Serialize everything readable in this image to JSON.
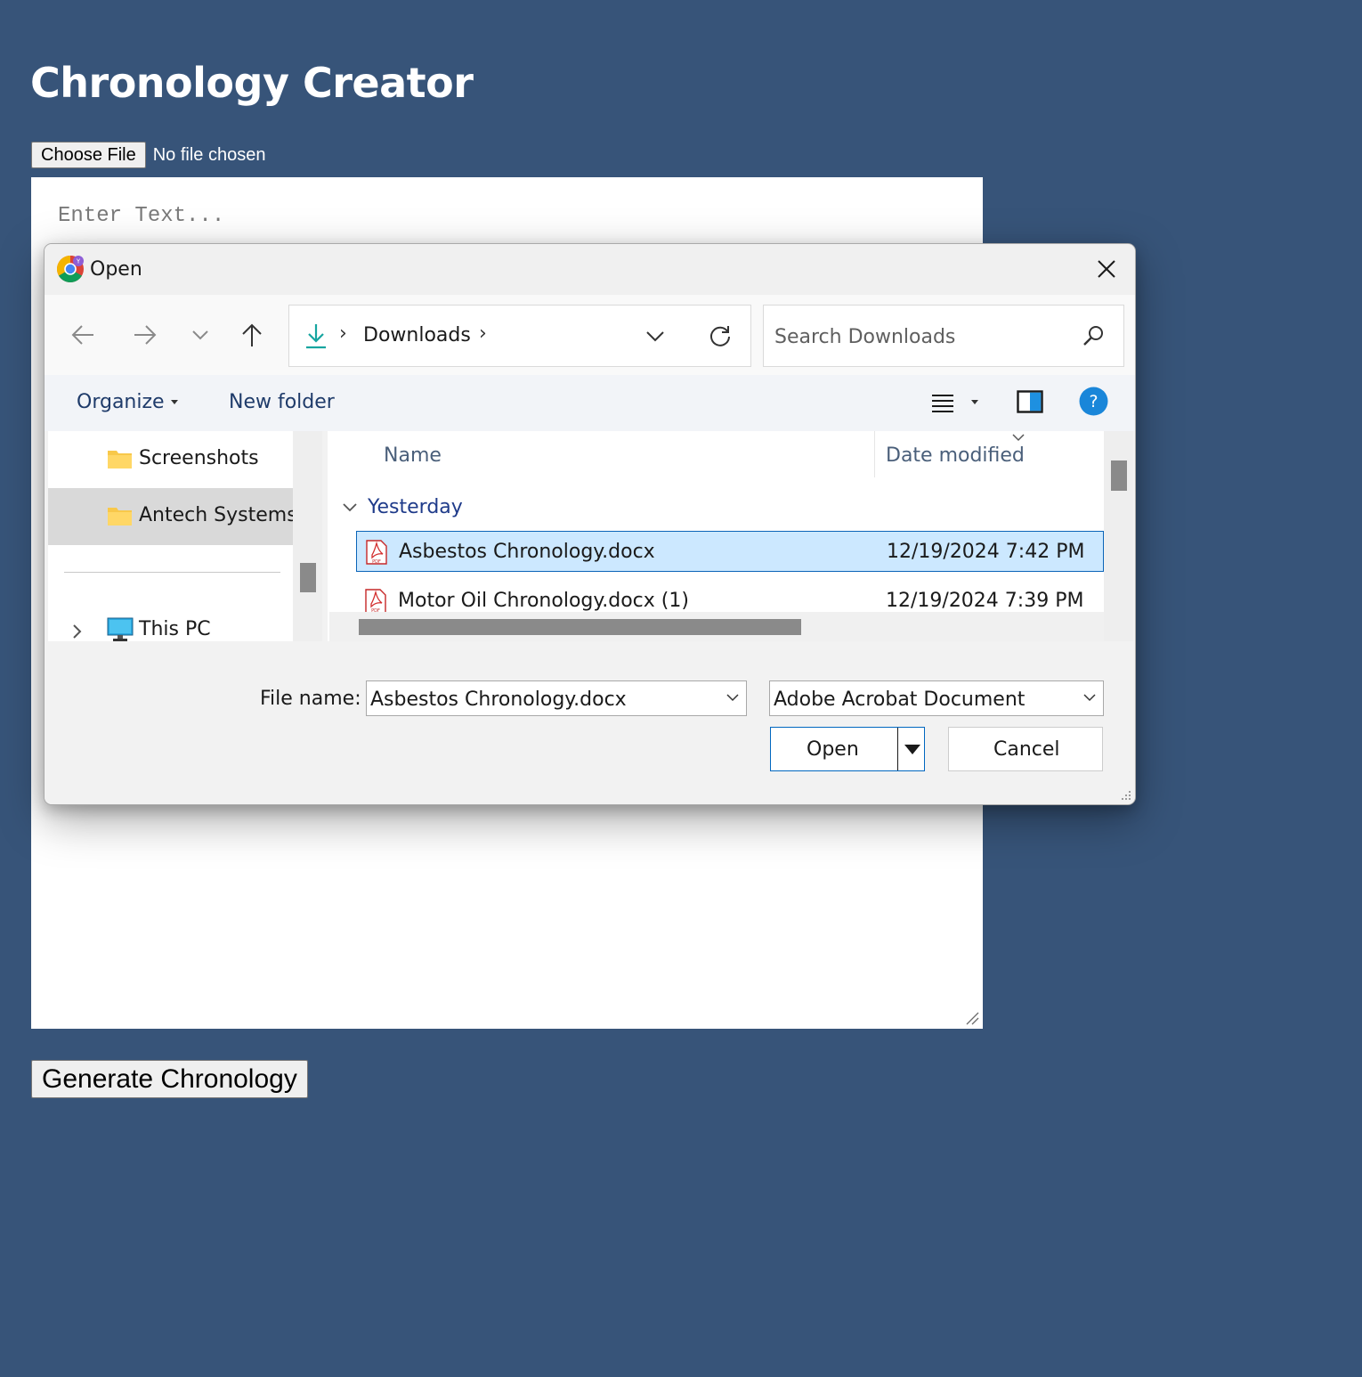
{
  "page": {
    "title": "Chronology Creator",
    "choose_file_label": "Choose File",
    "no_file_text": "No file chosen",
    "textarea_placeholder": "Enter Text...",
    "generate_label": "Generate Chronology",
    "background_color": "#375479"
  },
  "dialog": {
    "title": "Open",
    "app_icon": "chrome-icon",
    "nav": {
      "back_icon": "back-arrow-icon",
      "forward_icon": "forward-arrow-icon",
      "recent_icon": "chevron-down-icon",
      "up_icon": "up-arrow-icon",
      "location_icon": "download-icon",
      "location": "Downloads",
      "search_placeholder": "Search Downloads"
    },
    "toolbar": {
      "organize_label": "Organize",
      "new_folder_label": "New folder"
    },
    "sidebar": {
      "items": [
        {
          "label": "Screenshots",
          "icon": "folder-icon",
          "selected": false
        },
        {
          "label": "Antech Systems",
          "icon": "folder-icon",
          "selected": true
        },
        {
          "label": "This PC",
          "icon": "computer-icon",
          "selected": false
        }
      ]
    },
    "files": {
      "columns": [
        "Name",
        "Date modified"
      ],
      "group_label": "Yesterday",
      "rows": [
        {
          "name": "Asbestos Chronology.docx",
          "date": "12/19/2024 7:42 PM",
          "icon": "pdf-icon",
          "selected": true
        },
        {
          "name": "Motor Oil Chronology.docx (1)",
          "date": "12/19/2024 7:39 PM",
          "icon": "pdf-icon",
          "selected": false
        }
      ]
    },
    "footer": {
      "filename_label": "File name:",
      "filename_value": "Asbestos Chronology.docx",
      "filetype_value": "Adobe Acrobat Document",
      "open_label": "Open",
      "cancel_label": "Cancel"
    },
    "accent_color": "#0067c0",
    "selection_color": "#cce8ff"
  }
}
